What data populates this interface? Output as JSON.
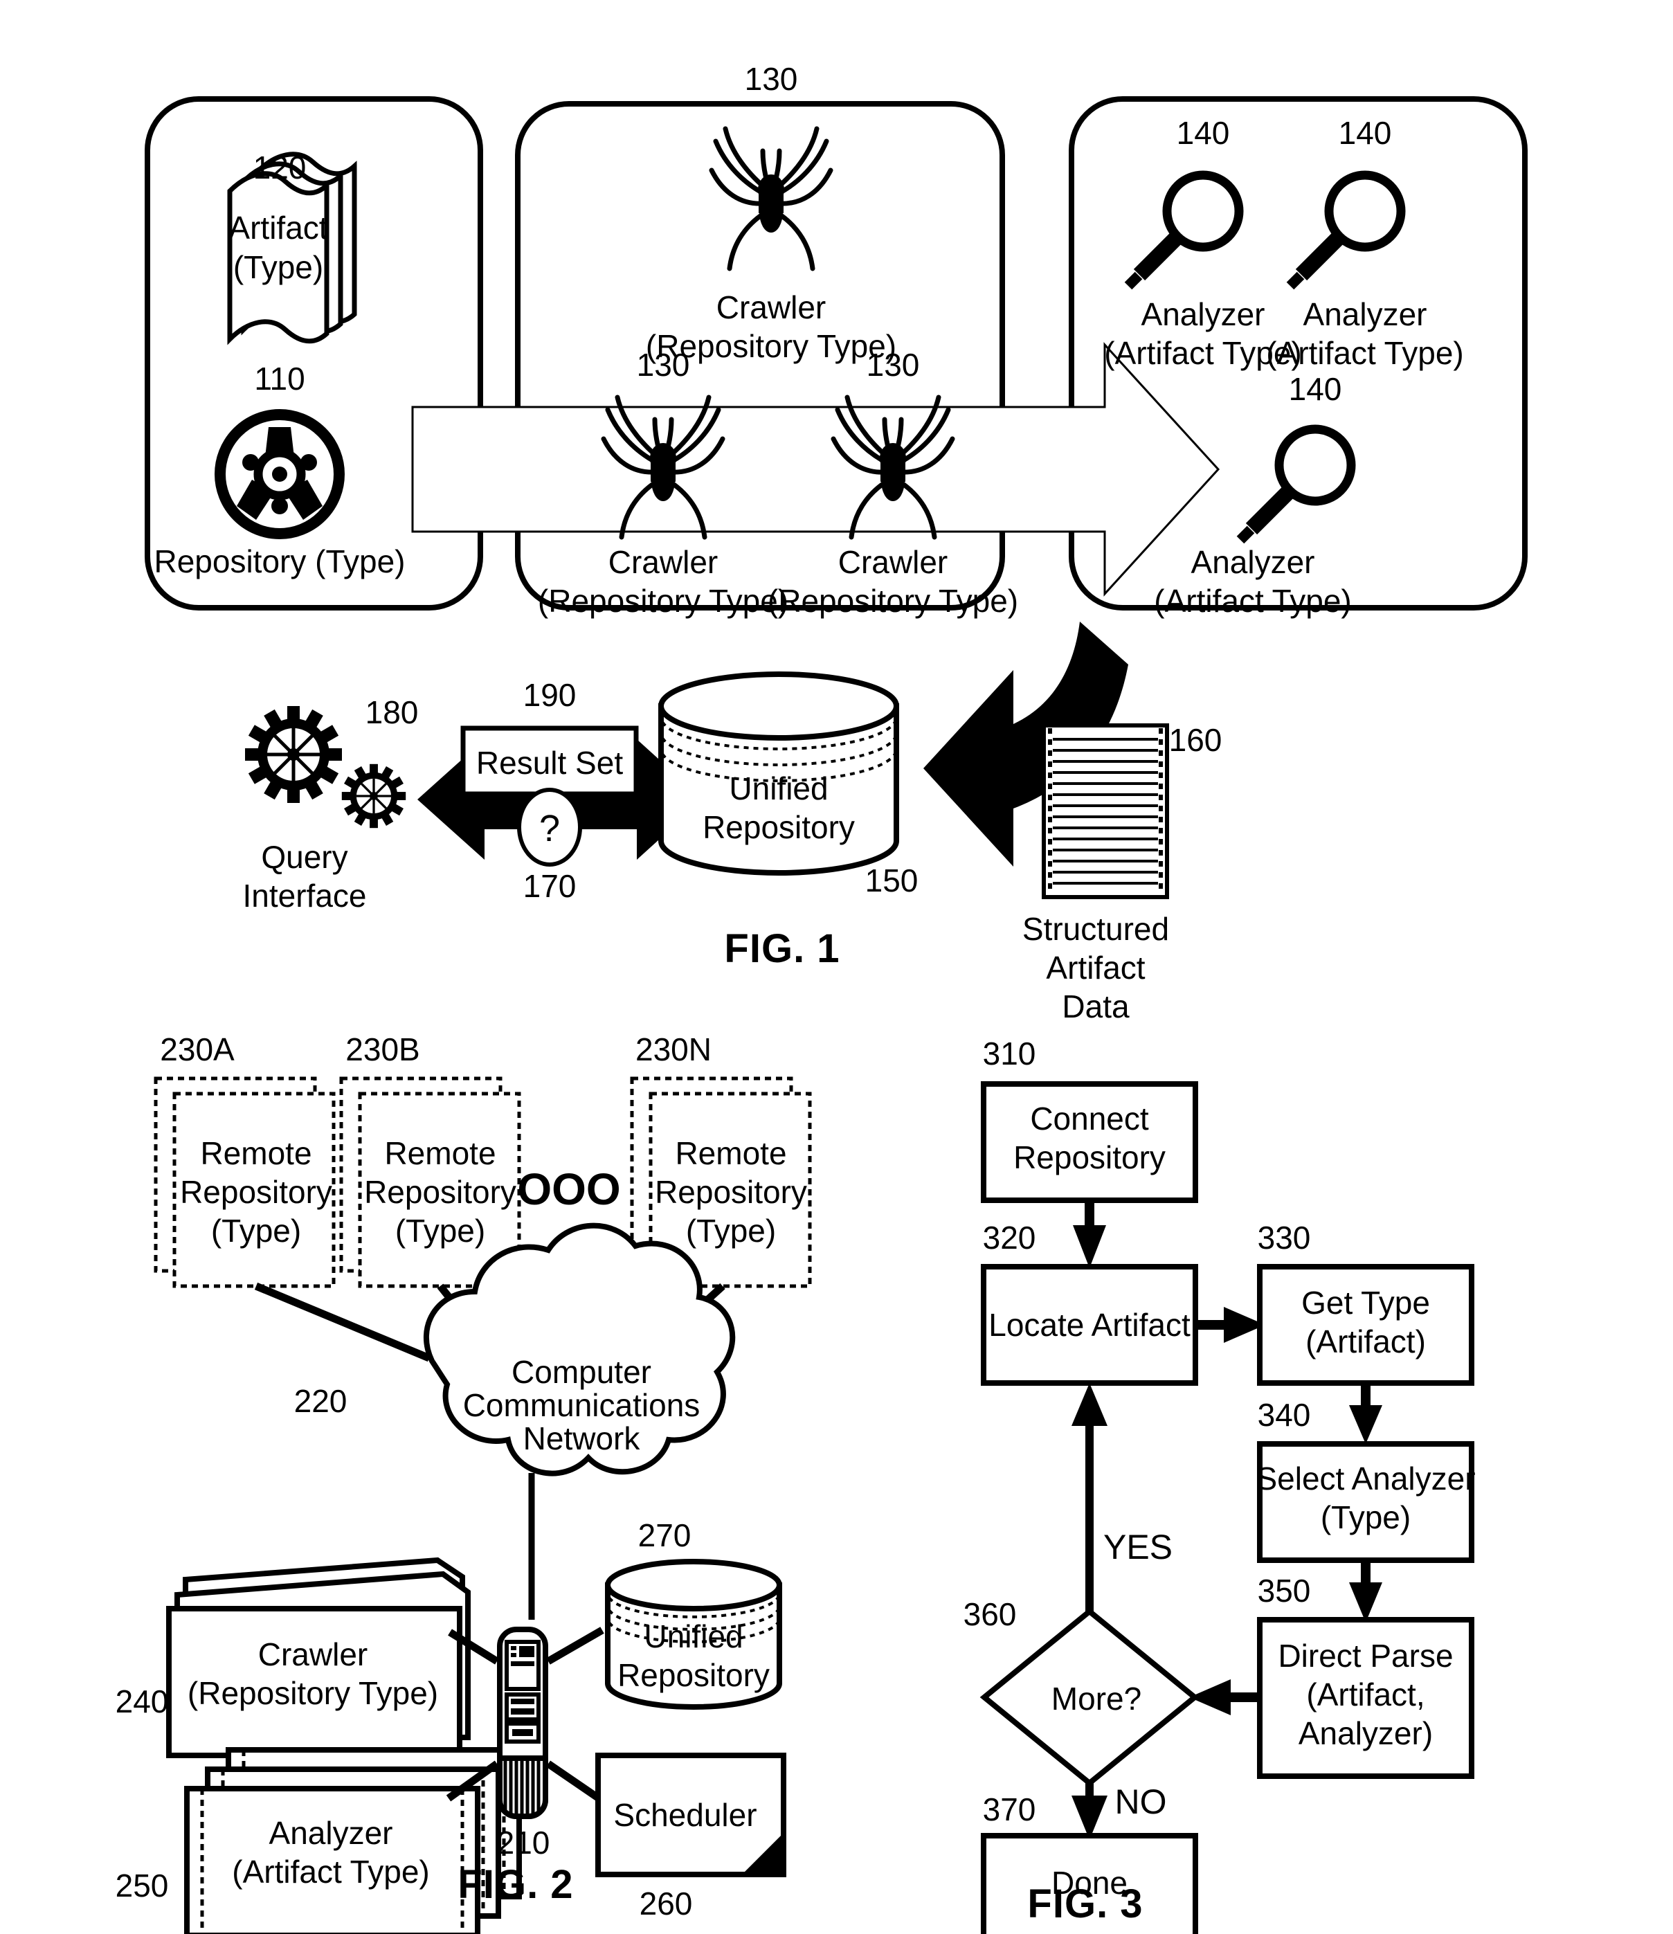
{
  "document": {
    "type": "patent-drawing-sheet",
    "figures": [
      "FIG. 1",
      "FIG. 2",
      "FIG. 3"
    ]
  },
  "fig1": {
    "caption": "FIG. 1",
    "groups": [
      {
        "name": "repository-group",
        "ref": "110"
      },
      {
        "name": "crawler-group",
        "ref": "130"
      },
      {
        "name": "analyzer-group",
        "ref": "140"
      }
    ],
    "artifact": {
      "ref": "120",
      "line1": "Artifact",
      "line2": "(Type)"
    },
    "repository": {
      "ref": "110",
      "label": "Repository (Type)"
    },
    "crawler_top": {
      "ref": "130",
      "line1": "Crawler",
      "line2": "(Repository Type)"
    },
    "crawler_left": {
      "ref": "130",
      "line1": "Crawler",
      "line2": "(Repository Type)"
    },
    "crawler_right": {
      "ref": "130",
      "line1": "Crawler",
      "line2": "(Repository Type)"
    },
    "analyzer_a": {
      "ref": "140",
      "line1": "Analyzer",
      "line2": "(Artifact Type)"
    },
    "analyzer_b": {
      "ref": "140",
      "line1": "Analyzer",
      "line2": "(Artifact Type)"
    },
    "analyzer_c": {
      "ref": "140",
      "line1": "Analyzer",
      "line2": "(Artifact Type)"
    },
    "query_interface": {
      "ref": "180",
      "line1": "Query",
      "line2": "Interface"
    },
    "result_set": {
      "ref": "190",
      "label": "Result Set"
    },
    "question": {
      "ref": "170",
      "label": "?"
    },
    "unified_repository": {
      "ref": "150",
      "line1": "Unified",
      "line2": "Repository"
    },
    "structured_artifact_data": {
      "ref": "160",
      "line1": "Structured",
      "line2": "Artifact",
      "line3": "Data"
    }
  },
  "fig2": {
    "caption": "FIG. 2",
    "remote_repositories": [
      {
        "ref": "230A",
        "line1": "Remote",
        "line2": "Repository",
        "line3": "(Type)"
      },
      {
        "ref": "230B",
        "line1": "Remote",
        "line2": "Repository",
        "line3": "(Type)"
      },
      {
        "ref": "230N",
        "line1": "Remote",
        "line2": "Repository",
        "line3": "(Type)"
      }
    ],
    "ellipsis": "OOO",
    "network": {
      "ref": "220",
      "line1": "Computer",
      "line2": "Communications",
      "line3": "Network"
    },
    "crawler": {
      "ref": "240",
      "line1": "Crawler",
      "line2": "(Repository Type)"
    },
    "analyzer": {
      "ref": "250",
      "line1": "Analyzer",
      "line2": "(Artifact Type)"
    },
    "server": {
      "ref": "210"
    },
    "unified_repository": {
      "ref": "270",
      "line1": "Unified",
      "line2": "Repository"
    },
    "scheduler": {
      "ref": "260",
      "label": "Scheduler"
    }
  },
  "fig3": {
    "caption": "FIG. 3",
    "steps": [
      {
        "ref": "310",
        "line1": "Connect",
        "line2": "Repository"
      },
      {
        "ref": "320",
        "line1": "Locate Artifact",
        "line2": ""
      },
      {
        "ref": "330",
        "line1": "Get Type",
        "line2": "(Artifact)"
      },
      {
        "ref": "340",
        "line1": "Select Analyzer",
        "line2": "(Type)"
      },
      {
        "ref": "350",
        "line1": "Direct Parse",
        "line2": "(Artifact,",
        "line3": "Analyzer)"
      },
      {
        "ref": "360",
        "line1": "More?",
        "line2": ""
      },
      {
        "ref": "370",
        "line1": "Done",
        "line2": ""
      }
    ],
    "branch_yes": "YES",
    "branch_no": "NO"
  }
}
